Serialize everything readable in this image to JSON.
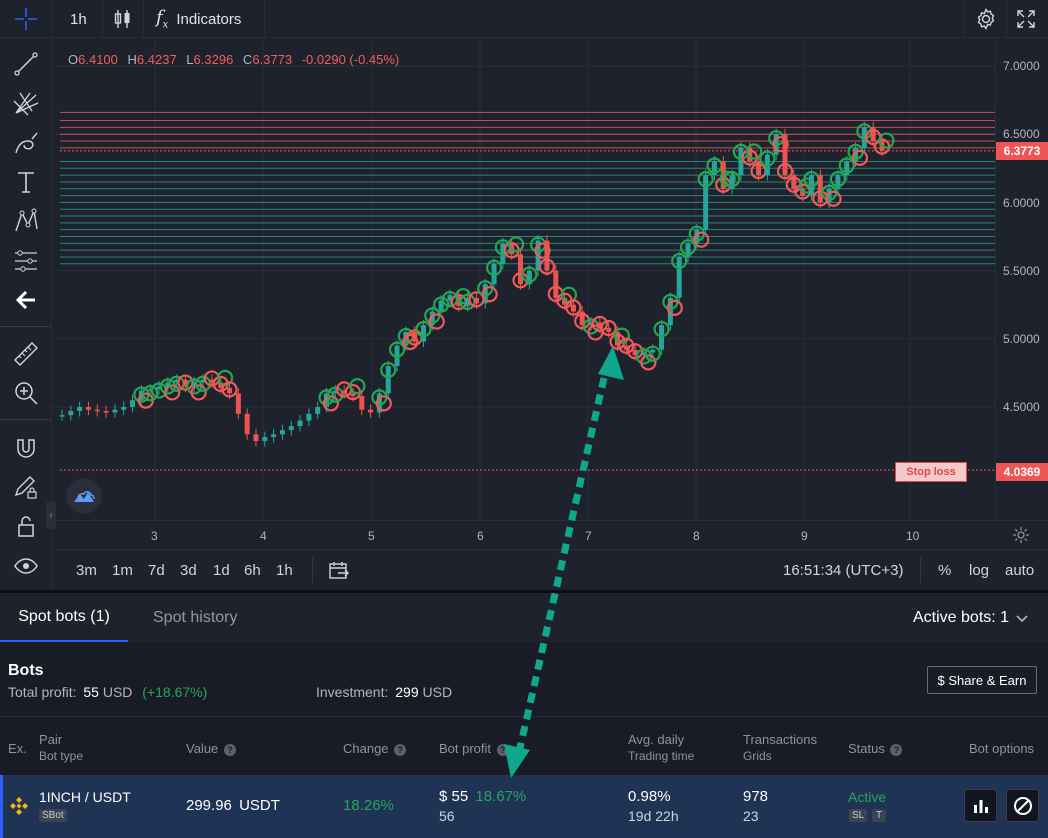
{
  "toolbar": {
    "interval": "1h",
    "indicators_label": "Indicators"
  },
  "ohlc": {
    "o_label": "O",
    "o": "6.4100",
    "h_label": "H",
    "h": "6.4237",
    "l_label": "L",
    "l": "6.3296",
    "c_label": "C",
    "c": "6.3773",
    "change": "-0.0290 (-0.45%)"
  },
  "price_axis": {
    "ticks": [
      "7.0000",
      "6.5000",
      "6.0000",
      "5.5000",
      "5.0000",
      "4.5000"
    ],
    "current_price": "6.3773",
    "stop_price": "4.0369"
  },
  "stop_loss_label": "Stop loss",
  "time_axis": {
    "ticks": [
      "3",
      "4",
      "5",
      "6",
      "7",
      "8",
      "9",
      "10"
    ]
  },
  "chart_data": {
    "type": "candlestick",
    "x_ticks": [
      "3",
      "4",
      "5",
      "6",
      "7",
      "8",
      "9",
      "10"
    ],
    "y_ticks": [
      7.0,
      6.5,
      6.0,
      5.5,
      5.0,
      4.5
    ],
    "ylim": [
      4.0,
      7.2
    ],
    "grid_levels_upper_sell": [
      6.66,
      6.6,
      6.55,
      6.5,
      6.45,
      6.4
    ],
    "grid_levels_lower_buy": [
      6.3,
      6.25,
      6.2,
      6.15,
      6.1,
      6.05,
      6.0,
      5.95,
      5.9,
      5.85,
      5.8,
      5.75,
      5.7,
      5.65,
      5.6,
      5.55
    ],
    "current_price": 6.3773,
    "stop_loss": 4.0369,
    "close_path": [
      4.44,
      4.47,
      4.5,
      4.48,
      4.47,
      4.46,
      4.48,
      4.5,
      4.55,
      4.62,
      4.63,
      4.65,
      4.68,
      4.7,
      4.65,
      4.68,
      4.7,
      4.68,
      4.64,
      4.6,
      4.45,
      4.3,
      4.25,
      4.28,
      4.3,
      4.33,
      4.36,
      4.4,
      4.45,
      4.5,
      4.6,
      4.62,
      4.6,
      4.58,
      4.48,
      4.46,
      4.6,
      4.8,
      4.95,
      5.05,
      4.98,
      5.1,
      5.2,
      5.28,
      5.32,
      5.24,
      5.3,
      5.26,
      5.4,
      5.55,
      5.7,
      5.62,
      5.4,
      5.5,
      5.72,
      5.5,
      5.3,
      5.25,
      5.2,
      5.1,
      5.12,
      5.08,
      5.05,
      4.95,
      4.92,
      4.88,
      4.9,
      4.92,
      5.1,
      5.3,
      5.6,
      5.7,
      5.8,
      6.2,
      6.3,
      6.1,
      6.2,
      6.4,
      6.3,
      6.2,
      6.35,
      6.5,
      6.2,
      6.1,
      6.05,
      6.2,
      6.0,
      6.1,
      6.2,
      6.3,
      6.4,
      6.55,
      6.45,
      6.38
    ]
  },
  "range_buttons": [
    "3m",
    "1m",
    "7d",
    "3d",
    "1d",
    "6h",
    "1h"
  ],
  "clock": "16:51:34 (UTC+3)",
  "scale_options": {
    "percent": "%",
    "log": "log",
    "auto": "auto"
  },
  "panel": {
    "tabs": [
      "Spot bots (1)",
      "Spot history"
    ],
    "active_bots": "Active bots: 1",
    "title": "Bots",
    "total_profit_label": "Total profit:",
    "total_profit_value": "55",
    "total_profit_currency": "USD",
    "total_profit_pct": "(+18.67%)",
    "investment_label": "Investment:",
    "investment_value": "299",
    "investment_currency": "USD",
    "share_button": "$ Share & Earn",
    "columns": {
      "ex": "Ex.",
      "pair": "Pair",
      "pair_sub": "Bot type",
      "value": "Value",
      "change": "Change",
      "bot_profit": "Bot profit",
      "avg_daily": "Avg. daily",
      "avg_daily_sub": "Trading time",
      "transactions": "Transactions",
      "transactions_sub": "Grids",
      "status": "Status",
      "options": "Bot options"
    },
    "row": {
      "pair": "1INCH / USDT",
      "bot_type": "SBot",
      "value": "299.96",
      "value_currency": "USDT",
      "change": "18.26%",
      "profit": "$ 55",
      "profit_pct": "18.67%",
      "profit_sub": "56",
      "avg_daily": "0.98%",
      "trading_time": "19d 22h",
      "transactions": "978",
      "grids": "23",
      "status": "Active",
      "tag_sl": "SL",
      "tag_t": "T"
    }
  },
  "colors": {
    "up": "#26a65b",
    "down": "#f05e5e",
    "accent": "#2962ff",
    "arrow": "#0fa88c"
  }
}
